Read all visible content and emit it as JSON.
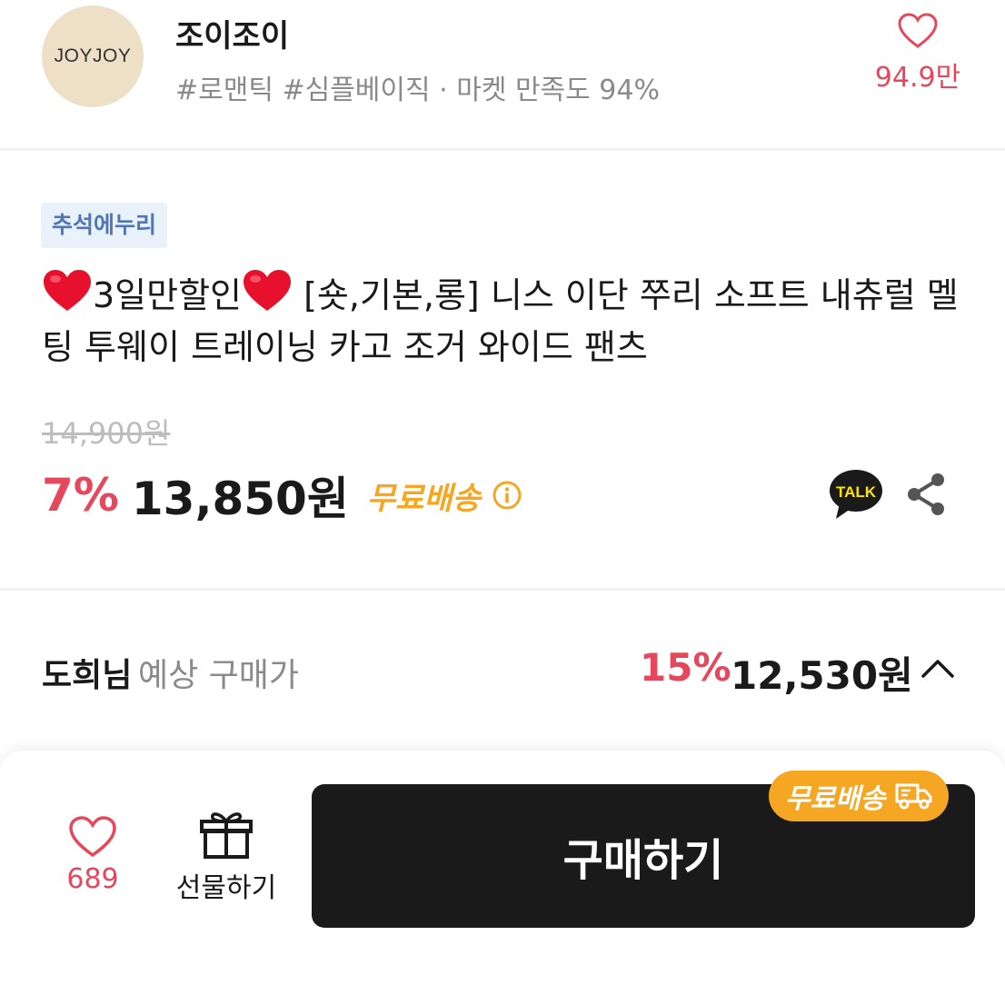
{
  "store": {
    "logo_text": "JOYJOY",
    "name": "조이조이",
    "tags": "#로맨틱 #심플베이직 · 마켓 만족도 94%",
    "like_count": "94.9만",
    "icon": "heart-outline-icon"
  },
  "product": {
    "badge": "추석에누리",
    "title_prefix": "3일만할인",
    "title_main": " [숏,기본,롱] 니스 이단 쭈리 소프트 내츄럴 멜팅 투웨이 트레이닝 카고 조거 와이드 팬츠",
    "original_price": "14,900원",
    "discount": "7%",
    "price": "13,850원",
    "shipping": "무료배송",
    "icons": [
      "heart-emoji-icon",
      "info-icon",
      "kakao-talk-icon",
      "share-icon"
    ]
  },
  "expected": {
    "user": "도희님",
    "label": " 예상 구매가",
    "discount": "15%",
    "price": "12,530원"
  },
  "bottom_bar": {
    "like_count": "689",
    "gift_label": "선물하기",
    "buy_label": "구매하기",
    "shipping_tag": "무료배송"
  },
  "colors": {
    "accent_red": "#e5485c",
    "shipping_orange": "#f5a623",
    "badge_blue": "#4f77b8",
    "button_dark": "#1a1a1a"
  }
}
